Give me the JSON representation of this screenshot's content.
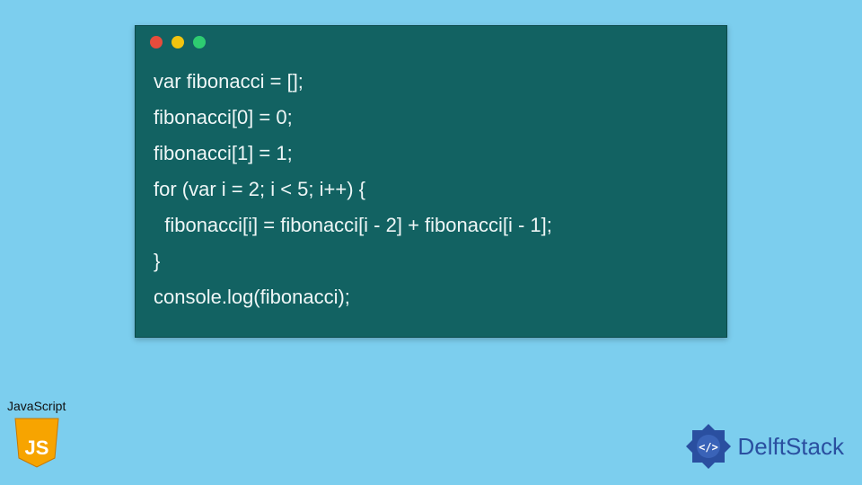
{
  "code": {
    "lines": [
      "var fibonacci = [];",
      "fibonacci[0] = 0;",
      "fibonacci[1] = 1;",
      "for (var i = 2; i < 5; i++) {",
      "  fibonacci[i] = fibonacci[i - 2] + fibonacci[i - 1];",
      "}",
      "console.log(fibonacci);"
    ]
  },
  "badges": {
    "js_label": "JavaScript",
    "js_shield_text": "JS",
    "delft_text": "DelftStack"
  },
  "colors": {
    "bg": "#7cceee",
    "window": "#126262",
    "dot_red": "#e74c3c",
    "dot_yellow": "#f1c40f",
    "dot_green": "#2ecc71",
    "js_yellow": "#f7a400",
    "delft_blue": "#2a4fa0"
  }
}
